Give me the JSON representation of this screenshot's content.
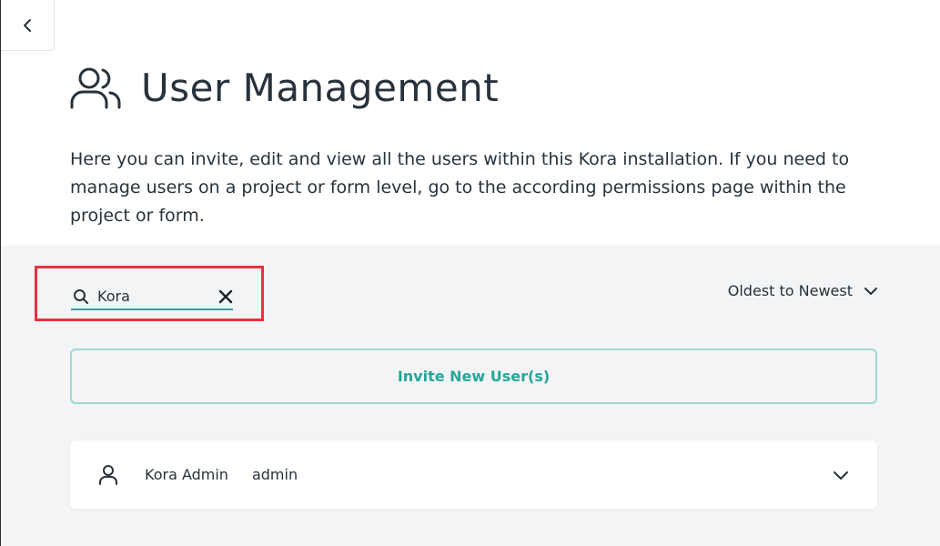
{
  "header": {
    "title": "User Management",
    "description": "Here you can invite, edit and view all the users within this Kora installation. If you need to manage users on a project or form level, go to the according permissions page within the project or form."
  },
  "search": {
    "value": "Kora",
    "placeholder": ""
  },
  "sort": {
    "selected": "Oldest to Newest"
  },
  "invite": {
    "label": "Invite New User(s)"
  },
  "users": [
    {
      "name": "Kora Admin",
      "username": "admin"
    }
  ],
  "colors": {
    "accent": "#26a69a",
    "highlight": "#e8323d",
    "text": "#28323c",
    "background": "#f2f4f6"
  },
  "icons": {
    "back": "chevron-left-icon",
    "title": "users-icon",
    "search": "search-icon",
    "clear": "close-icon",
    "sort": "chevron-down-icon",
    "user": "user-icon",
    "expand": "chevron-down-icon"
  }
}
